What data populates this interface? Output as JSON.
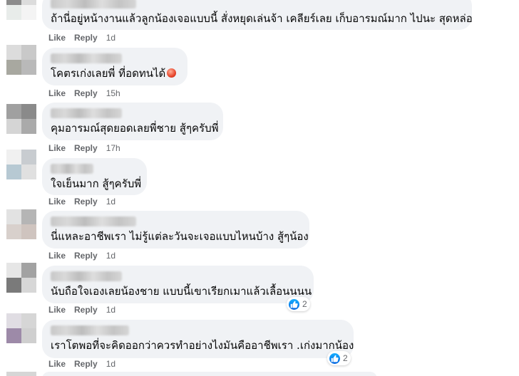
{
  "comments": [
    {
      "text": "ถ้านี่อยู่หน้างานแล้วลูกน้องเจอแบบนี้ สั่งหยุดเล่นจ้า เคลียร์เลย เก็บอารมณ์มาก ไปนะ สุดหล่อ",
      "like": "Like",
      "reply": "Reply",
      "time": "1d"
    },
    {
      "text": "โคตรเก่งเลยพี่ ที่อดทนได้",
      "like": "Like",
      "reply": "Reply",
      "time": "15h"
    },
    {
      "text": "คุมอารมณ์สุดยอดเลยพี่ชาย สู้ๆครับพี่",
      "like": "Like",
      "reply": "Reply",
      "time": "17h"
    },
    {
      "text": "ใจเย็นมาก สู้ๆครับพี่",
      "like": "Like",
      "reply": "Reply",
      "time": "1d"
    },
    {
      "text": "นี่แหละอาชีพเรา ไม่รู้แต่ละวันจะเจอแบบไหนบ้าง สู้ๆน้อง",
      "like": "Like",
      "reply": "Reply",
      "time": "1d"
    },
    {
      "text": "นับถือใจเองเลยน้องชาย แบบนี้เขาเรียกเมาแล้วเลื้อนนนน",
      "like": "Like",
      "reply": "Reply",
      "time": "1d",
      "reaction_count": "2"
    },
    {
      "text": "เราโตพอที่จะคิดออกว่าควรทำอย่างไงมันคืออาชีพเรา .เก่งมากน้อง",
      "like": "Like",
      "reply": "Reply",
      "time": "1d",
      "reaction_count": "2"
    }
  ],
  "icons": {
    "reaction": "like-reaction-icon",
    "emoji": "peach-emoji-icon"
  },
  "colors": {
    "bubble": "#f0f2f5",
    "action_text": "#65676b",
    "like_blue": "#0062df"
  }
}
